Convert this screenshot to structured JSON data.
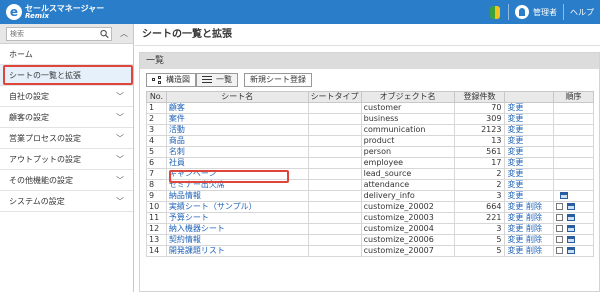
{
  "header": {
    "logo_title": "セールスマネージャー",
    "logo_sub": "Remix",
    "admin_label": "管理者",
    "help_label": "ヘルプ"
  },
  "sidebar": {
    "search_placeholder": "検索",
    "items": [
      {
        "label": "ホーム",
        "chevron": false,
        "active": false
      },
      {
        "label": "シートの一覧と拡張",
        "chevron": false,
        "active": true
      },
      {
        "label": "自社の設定",
        "chevron": true,
        "active": false
      },
      {
        "label": "顧客の設定",
        "chevron": true,
        "active": false
      },
      {
        "label": "営業プロセスの設定",
        "chevron": true,
        "active": false
      },
      {
        "label": "アウトプットの設定",
        "chevron": true,
        "active": false
      },
      {
        "label": "その他機能の設定",
        "chevron": true,
        "active": false
      },
      {
        "label": "システムの設定",
        "chevron": true,
        "active": false
      }
    ]
  },
  "main": {
    "page_title": "シートの一覧と拡張",
    "panel_title": "一覧",
    "tabs": {
      "tree_view": "構造図",
      "list_view": "一覧",
      "new_sheet": "新規シート登録"
    },
    "table": {
      "headers": [
        "No.",
        "シート名",
        "シートタイプ",
        "オブジェクト名",
        "登録件数",
        "",
        "順序"
      ],
      "rows": [
        {
          "no": "1",
          "name": "顧客",
          "type": "",
          "object": "customer",
          "count": "70",
          "ops": "変更",
          "check": false
        },
        {
          "no": "2",
          "name": "案件",
          "type": "",
          "object": "business",
          "count": "309",
          "ops": "変更",
          "check": false
        },
        {
          "no": "3",
          "name": "活動",
          "type": "",
          "object": "communication",
          "count": "2123",
          "ops": "変更",
          "check": false
        },
        {
          "no": "4",
          "name": "商品",
          "type": "",
          "object": "product",
          "count": "13",
          "ops": "変更",
          "check": false
        },
        {
          "no": "5",
          "name": "名刺",
          "type": "",
          "object": "person",
          "count": "561",
          "ops": "変更",
          "check": false
        },
        {
          "no": "6",
          "name": "社員",
          "type": "",
          "object": "employee",
          "count": "17",
          "ops": "変更",
          "check": false
        },
        {
          "no": "7",
          "name": "キャンペーン",
          "type": "",
          "object": "lead_source",
          "count": "2",
          "ops": "変更",
          "check": false
        },
        {
          "no": "8",
          "name": "セミナー出欠席",
          "type": "",
          "object": "attendance",
          "count": "2",
          "ops": "変更",
          "check": false
        },
        {
          "no": "9",
          "name": "納品情報",
          "type": "",
          "object": "delivery_info",
          "count": "3",
          "ops": "変更",
          "check": false
        },
        {
          "no": "10",
          "name": "実績シート（サンプル）",
          "type": "",
          "object": "customize_20002",
          "count": "664",
          "ops": "変更 削除",
          "check": true
        },
        {
          "no": "11",
          "name": "予算シート",
          "type": "",
          "object": "customize_20003",
          "count": "221",
          "ops": "変更 削除",
          "check": true
        },
        {
          "no": "12",
          "name": "納入機器シート",
          "type": "",
          "object": "customize_20004",
          "count": "3",
          "ops": "変更 削除",
          "check": true
        },
        {
          "no": "13",
          "name": "契約情報",
          "type": "",
          "object": "customize_20006",
          "count": "5",
          "ops": "変更 削除",
          "check": true
        },
        {
          "no": "14",
          "name": "開発課題リスト",
          "type": "",
          "object": "customize_20007",
          "count": "5",
          "ops": "変更 削除",
          "check": true
        }
      ]
    }
  }
}
